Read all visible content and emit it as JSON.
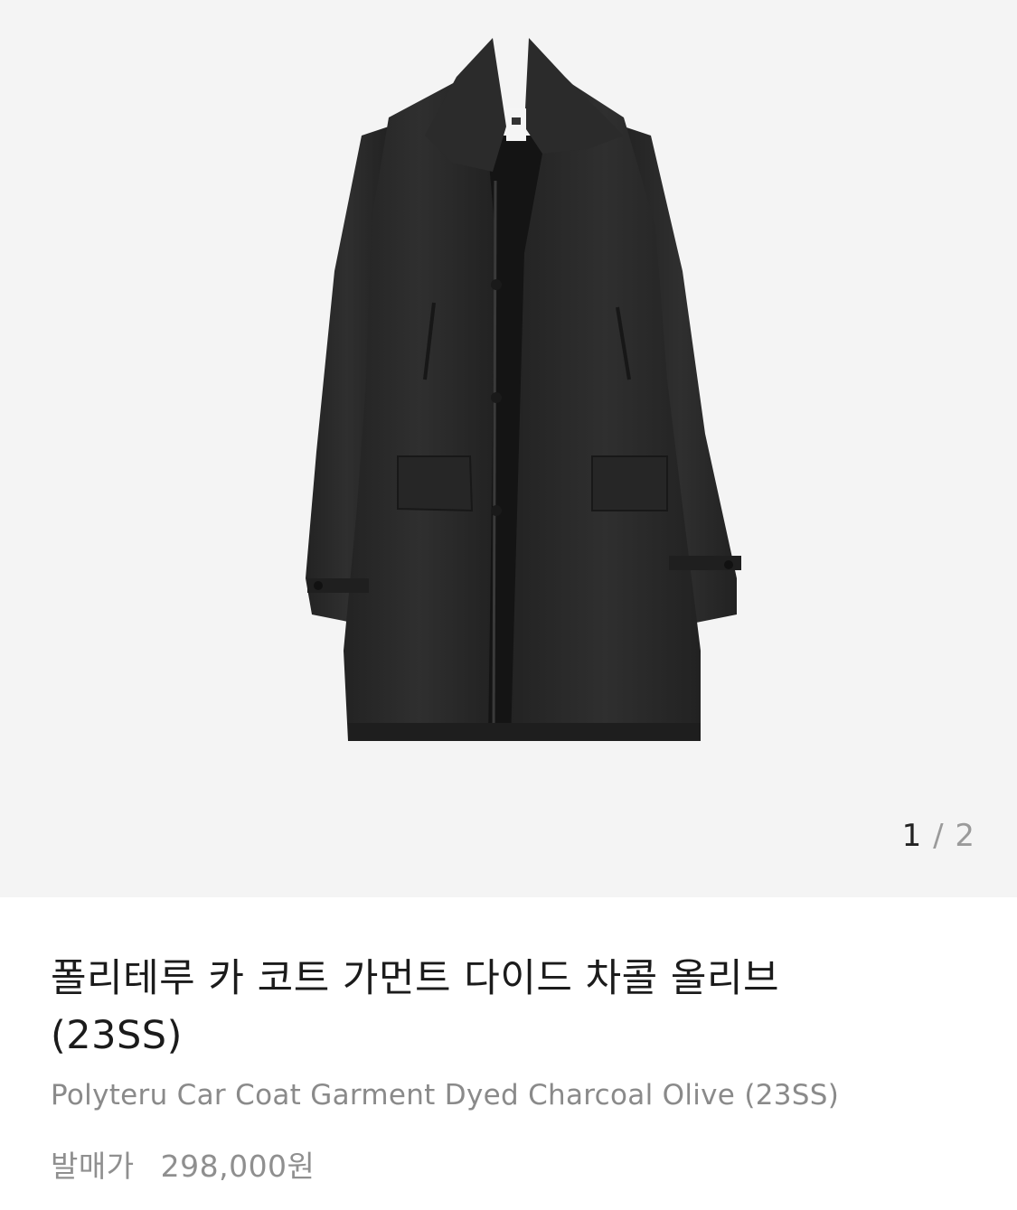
{
  "gallery": {
    "current": "1",
    "separator": "/",
    "total": "2"
  },
  "product": {
    "title_ko_line1": "폴리테루 카 코트 가먼트 다이드 차콜 올리브",
    "title_ko_line2": "(23SS)",
    "title_en": "Polyteru Car Coat Garment Dyed Charcoal Olive (23SS)",
    "price_label": "발매가",
    "price_value": "298,000원"
  },
  "colors": {
    "gallery_bg": "#f4f4f4",
    "coat": "#2a2a2a"
  }
}
